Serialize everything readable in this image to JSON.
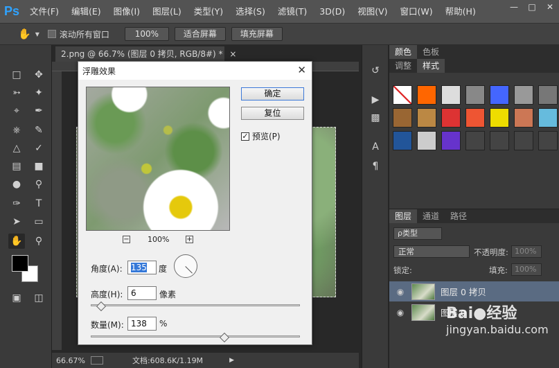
{
  "menubar": {
    "logo": "Ps",
    "items": [
      "文件(F)",
      "编辑(E)",
      "图像(I)",
      "图层(L)",
      "类型(Y)",
      "选择(S)",
      "滤镜(T)",
      "3D(D)",
      "视图(V)",
      "窗口(W)",
      "帮助(H)"
    ]
  },
  "window_controls": {
    "minimize": "—",
    "maximize": "□",
    "close": "✕"
  },
  "options": {
    "scroll_all": "滚动所有窗口",
    "zoom_100": "100%",
    "fit_screen": "适合屏幕",
    "fill_screen": "填充屏幕"
  },
  "document": {
    "tab_title": "2.png @ 66.7% (图层 0 拷贝, RGB/8#) *",
    "tab_close": "×",
    "zoom": "66.67%",
    "doc_info": "文档:608.6K/1.19M"
  },
  "panels": {
    "color_tab": "颜色",
    "swatches_tab": "色板",
    "adjust_tab": "调整",
    "styles_tab": "样式",
    "layers_tab": "图层",
    "channels_tab": "通道",
    "paths_tab": "路径",
    "kind_filter": "ρ类型",
    "blend_mode": "正常",
    "opacity_label": "不透明度:",
    "opacity_value": "100%",
    "lock_label": "锁定:",
    "fill_label": "填充:",
    "fill_value": "100%",
    "layers": [
      {
        "name": "图层 0 拷贝",
        "selected": true
      },
      {
        "name": "图层 0",
        "selected": false
      }
    ],
    "style_colors": [
      "#c22",
      "#f60",
      "#ddd",
      "#888",
      "#46f",
      "#999",
      "#777",
      "#963",
      "#b84",
      "#d33",
      "#e53",
      "#ed0",
      "#c75",
      "#6bd",
      "#259",
      "#ccc",
      "#63c",
      "#444",
      "#444",
      "#444",
      "#444"
    ]
  },
  "watermark": {
    "line1": "Bai●经验",
    "line2": "jingyan.baidu.com"
  },
  "dialog": {
    "title": "浮雕效果",
    "close": "✕",
    "ok": "确定",
    "reset": "复位",
    "preview_label": "预览(P)",
    "preview_checked": "✓",
    "zoom_minus": "−",
    "zoom_plus": "+",
    "zoom_value": "100%",
    "angle_label": "角度(A):",
    "angle_value": "135",
    "angle_unit": "度",
    "height_label": "高度(H):",
    "height_value": "6",
    "height_unit": "像素",
    "amount_label": "数量(M):",
    "amount_value": "138",
    "amount_unit": "%",
    "height_slider_fraction": 0.05,
    "amount_slider_fraction": 0.64
  }
}
